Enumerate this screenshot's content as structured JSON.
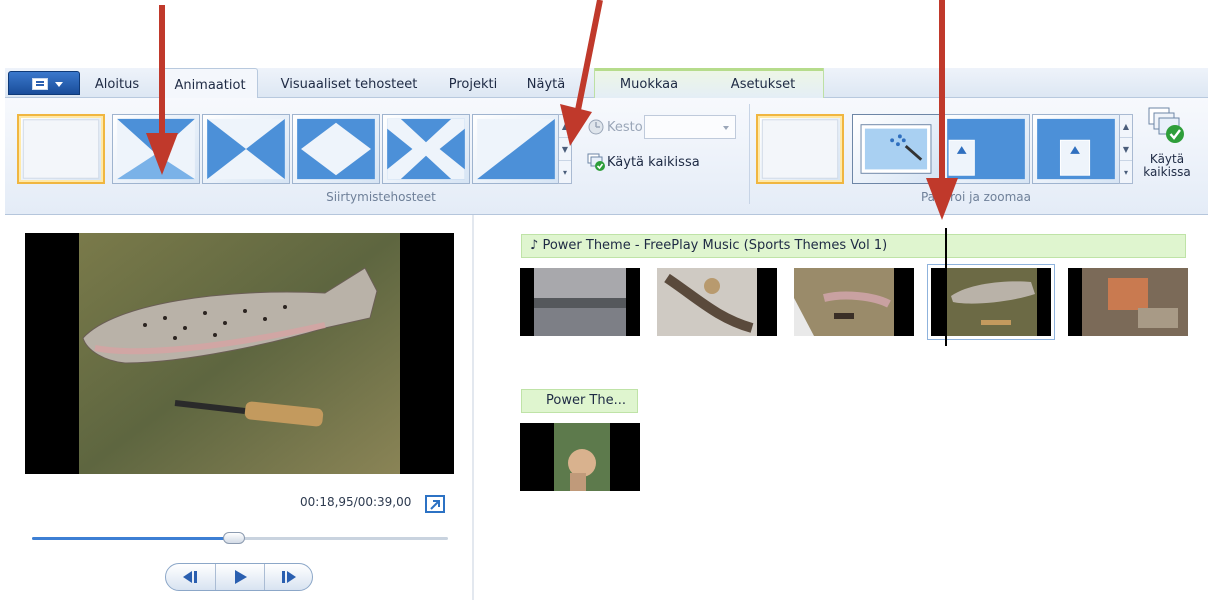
{
  "tabs": [
    {
      "label": "Aloitus"
    },
    {
      "label": "Animaatiot"
    },
    {
      "label": "Visuaaliset tehosteet"
    },
    {
      "label": "Projekti"
    },
    {
      "label": "Näytä"
    },
    {
      "label": "Muokkaa"
    },
    {
      "label": "Asetukset"
    }
  ],
  "active_tab": "Animaatiot",
  "ribbon": {
    "transitions_group_label": "Siirtymistehosteet",
    "duration_label": "Kesto:",
    "duration_value": "",
    "apply_all_label": "Käytä kaikissa",
    "panzoom_group_label": "Panoroi ja zoomaa",
    "panzoom_apply_all_line1": "Käytä",
    "panzoom_apply_all_line2": "kaikissa"
  },
  "preview": {
    "time": "00:18,95/00:39,00",
    "progress": 0.486
  },
  "storyboard": {
    "music_track_1": "Power Theme - FreePlay Music (Sports Themes Vol 1)",
    "music_track_2": "Power The..."
  },
  "colors": {
    "arrow": "#c0392b",
    "selection": "#f0b640",
    "music_bar": "#dff5cf",
    "accent": "#3d7fd4"
  }
}
